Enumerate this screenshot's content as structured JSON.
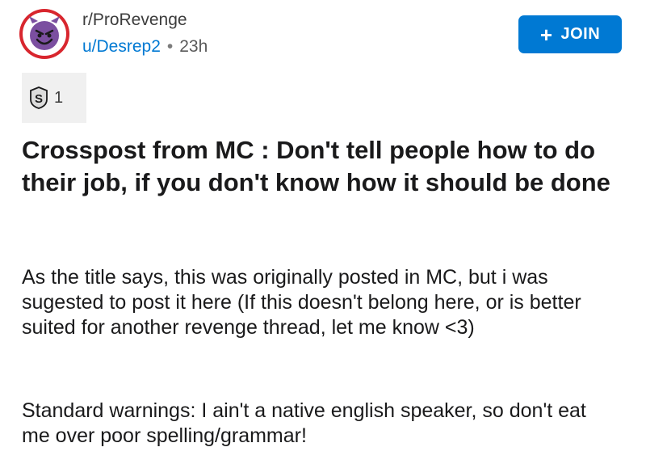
{
  "post": {
    "subreddit": "r/ProRevenge",
    "author": "u/Desrep2",
    "separator": "•",
    "age": "23h",
    "join_label": "JOIN",
    "award_count": "1",
    "title": "Crosspost from MC : Don't tell people how to do their job, if you don't know how it should be done",
    "paragraphs": [
      "As the title says, this was originally posted in MC, but i was sugested to post it here (If this doesn't belong here, or is better suited for another revenge thread, let me know <3)",
      "Standard warnings: I ain't a native english speaker, so don't eat me over poor spelling/grammar!"
    ]
  },
  "icons": {
    "avatar": "devil-face-icon",
    "join": "plus-icon",
    "award": "silver-award-icon"
  },
  "colors": {
    "accent": "#0079d3",
    "avatar_ring": "#d8262e",
    "devil_face": "#7b4fa0"
  }
}
